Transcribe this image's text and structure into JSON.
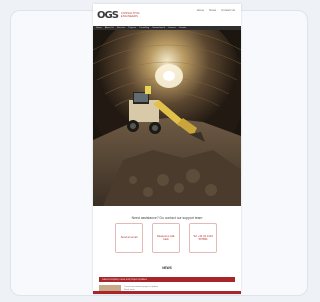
{
  "logo": {
    "mark": "OGS",
    "text_line1": "CONSULTING",
    "text_line2": "ENGINEERS"
  },
  "top_links": [
    "Home",
    "News",
    "Contact Us"
  ],
  "nav": [
    "Home",
    "About Us",
    "Services",
    "Projects",
    "Tunnelling",
    "Geotechnical",
    "Careers",
    "Contact"
  ],
  "contact": {
    "title": "Need assistance? Do contact our support team",
    "boxes": [
      "Send an email",
      "Request a Call-back",
      "Tel: +44 (0) 1234 567890"
    ]
  },
  "news": {
    "title": "NEWS",
    "bar_text": "Latest company news and project updates",
    "item_line1": "Tunnel excavation progress update",
    "item_line2": "Read more"
  },
  "colors": {
    "brand_red": "#b32d2e",
    "nav_dark": "#2f2f2f"
  }
}
